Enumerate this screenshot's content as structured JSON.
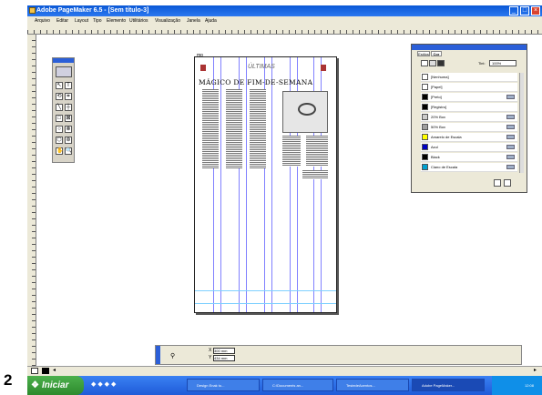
{
  "window": {
    "title": "Adobe PageMaker 6.5 - [Sem título-3]",
    "buttons": [
      "_",
      "□",
      "×"
    ]
  },
  "menu": [
    "Arquivo",
    "Editar",
    "Layout",
    "Tipo",
    "Elemento",
    "Utilitários",
    "Visualização",
    "Janela",
    "Ajuda"
  ],
  "document": {
    "header_small": "mo",
    "masthead": "ÚLTIMAS",
    "headline": "MÁGICO  DE  FIM-DE-SEMANA"
  },
  "color_palette": {
    "tabs": [
      "Estilos",
      "Cor"
    ],
    "tint_label": "Tint:",
    "tint_value": "100%",
    "colors": [
      {
        "name": "[Nenhuma]",
        "hex": "#ffffff"
      },
      {
        "name": "[Papel]",
        "hex": "#ffffff"
      },
      {
        "name": "[Preto]",
        "hex": "#000000"
      },
      {
        "name": "[Registro]",
        "hex": "#000000"
      },
      {
        "name": "20% Box",
        "hex": "#cccccc"
      },
      {
        "name": "50% Box",
        "hex": "#a0a0a0"
      },
      {
        "name": "Amarelo de Escala",
        "hex": "#ffff00"
      },
      {
        "name": "Azul",
        "hex": "#0000c0"
      },
      {
        "name": "Black",
        "hex": "#000000"
      },
      {
        "name": "Ciano de Escala",
        "hex": "#00a0d0"
      }
    ]
  },
  "control_palette": {
    "x_label": "X",
    "x_value": "300 mm",
    "y_label": "Y",
    "y_value": "434 mm"
  },
  "page_indicator": "2",
  "taskbar": {
    "start_label": "Iniciar",
    "tasks": [
      "Design Enak to...",
      "C:\\Documents an...",
      "TestedeAcentos...",
      "Adobe PageMaker..."
    ],
    "clock": "12:08"
  }
}
